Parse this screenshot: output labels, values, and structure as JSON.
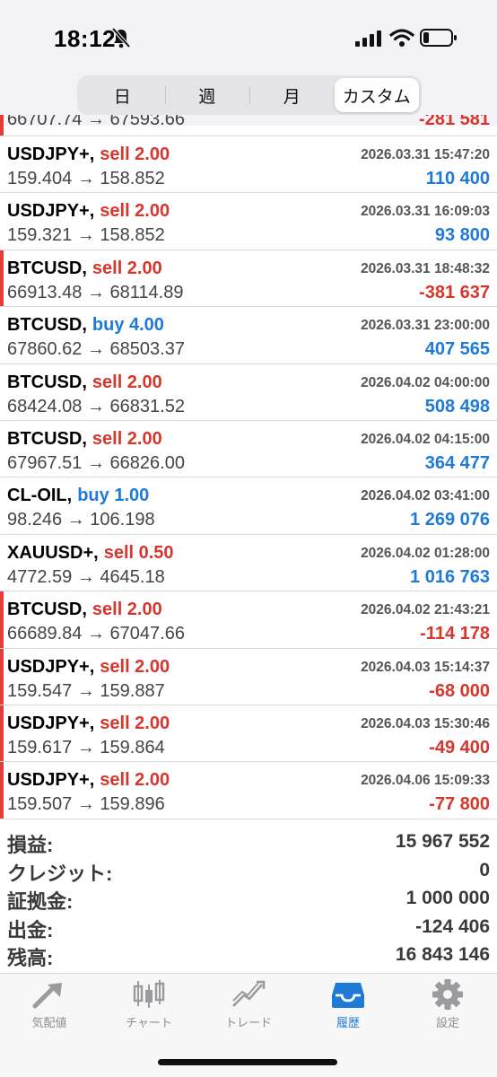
{
  "status": {
    "time": "18:12"
  },
  "periods": [
    {
      "label": "日",
      "active": false
    },
    {
      "label": "週",
      "active": false
    },
    {
      "label": "月",
      "active": false
    },
    {
      "label": "カスタム",
      "active": true
    }
  ],
  "partial_row": {
    "prices": "66707.74 → 67593.66",
    "profit": "-281 581",
    "loss": true
  },
  "deals": [
    {
      "symbol": "USDJPY+,",
      "side": "sell",
      "volume": "sell 2.00",
      "datetime": "2026.03.31 15:47:20",
      "prices": "159.404 → 158.852",
      "profit": "110 400",
      "loss": false
    },
    {
      "symbol": "USDJPY+,",
      "side": "sell",
      "volume": "sell 2.00",
      "datetime": "2026.03.31 16:09:03",
      "prices": "159.321 → 158.852",
      "profit": "93 800",
      "loss": false
    },
    {
      "symbol": "BTCUSD,",
      "side": "sell",
      "volume": "sell 2.00",
      "datetime": "2026.03.31 18:48:32",
      "prices": "66913.48 → 68114.89",
      "profit": "-381 637",
      "loss": true
    },
    {
      "symbol": "BTCUSD,",
      "side": "buy",
      "volume": "buy 4.00",
      "datetime": "2026.03.31 23:00:00",
      "prices": "67860.62 → 68503.37",
      "profit": "407 565",
      "loss": false
    },
    {
      "symbol": "BTCUSD,",
      "side": "sell",
      "volume": "sell 2.00",
      "datetime": "2026.04.02 04:00:00",
      "prices": "68424.08 → 66831.52",
      "profit": "508 498",
      "loss": false
    },
    {
      "symbol": "BTCUSD,",
      "side": "sell",
      "volume": "sell 2.00",
      "datetime": "2026.04.02 04:15:00",
      "prices": "67967.51 → 66826.00",
      "profit": "364 477",
      "loss": false
    },
    {
      "symbol": "CL-OIL,",
      "side": "buy",
      "volume": "buy 1.00",
      "datetime": "2026.04.02 03:41:00",
      "prices": "98.246 → 106.198",
      "profit": "1 269 076",
      "loss": false
    },
    {
      "symbol": "XAUUSD+,",
      "side": "sell",
      "volume": "sell 0.50",
      "datetime": "2026.04.02 01:28:00",
      "prices": "4772.59 → 4645.18",
      "profit": "1 016 763",
      "loss": false
    },
    {
      "symbol": "BTCUSD,",
      "side": "sell",
      "volume": "sell 2.00",
      "datetime": "2026.04.02 21:43:21",
      "prices": "66689.84 → 67047.66",
      "profit": "-114 178",
      "loss": true
    },
    {
      "symbol": "USDJPY+,",
      "side": "sell",
      "volume": "sell 2.00",
      "datetime": "2026.04.03 15:14:37",
      "prices": "159.547 → 159.887",
      "profit": "-68 000",
      "loss": true
    },
    {
      "symbol": "USDJPY+,",
      "side": "sell",
      "volume": "sell 2.00",
      "datetime": "2026.04.03 15:30:46",
      "prices": "159.617 → 159.864",
      "profit": "-49 400",
      "loss": true
    },
    {
      "symbol": "USDJPY+,",
      "side": "sell",
      "volume": "sell 2.00",
      "datetime": "2026.04.06 15:09:33",
      "prices": "159.507 → 159.896",
      "profit": "-77 800",
      "loss": true
    }
  ],
  "summary": [
    {
      "label": "損益:",
      "value": "15 967 552"
    },
    {
      "label": "クレジット:",
      "value": "0"
    },
    {
      "label": "証拠金:",
      "value": "1 000 000"
    },
    {
      "label": "出金:",
      "value": "-124 406"
    },
    {
      "label": "残高:",
      "value": "16 843 146"
    }
  ],
  "tabs": [
    {
      "label": "気配値",
      "icon": "quotes-icon",
      "active": false
    },
    {
      "label": "チャート",
      "icon": "chart-icon",
      "active": false
    },
    {
      "label": "トレード",
      "icon": "trade-icon",
      "active": false
    },
    {
      "label": "履歴",
      "icon": "history-icon",
      "active": true
    },
    {
      "label": "設定",
      "icon": "settings-icon",
      "active": false
    }
  ],
  "colors": {
    "loss": "#d6362b",
    "profit": "#1e7ad6",
    "accent": "#1e7ad6"
  }
}
